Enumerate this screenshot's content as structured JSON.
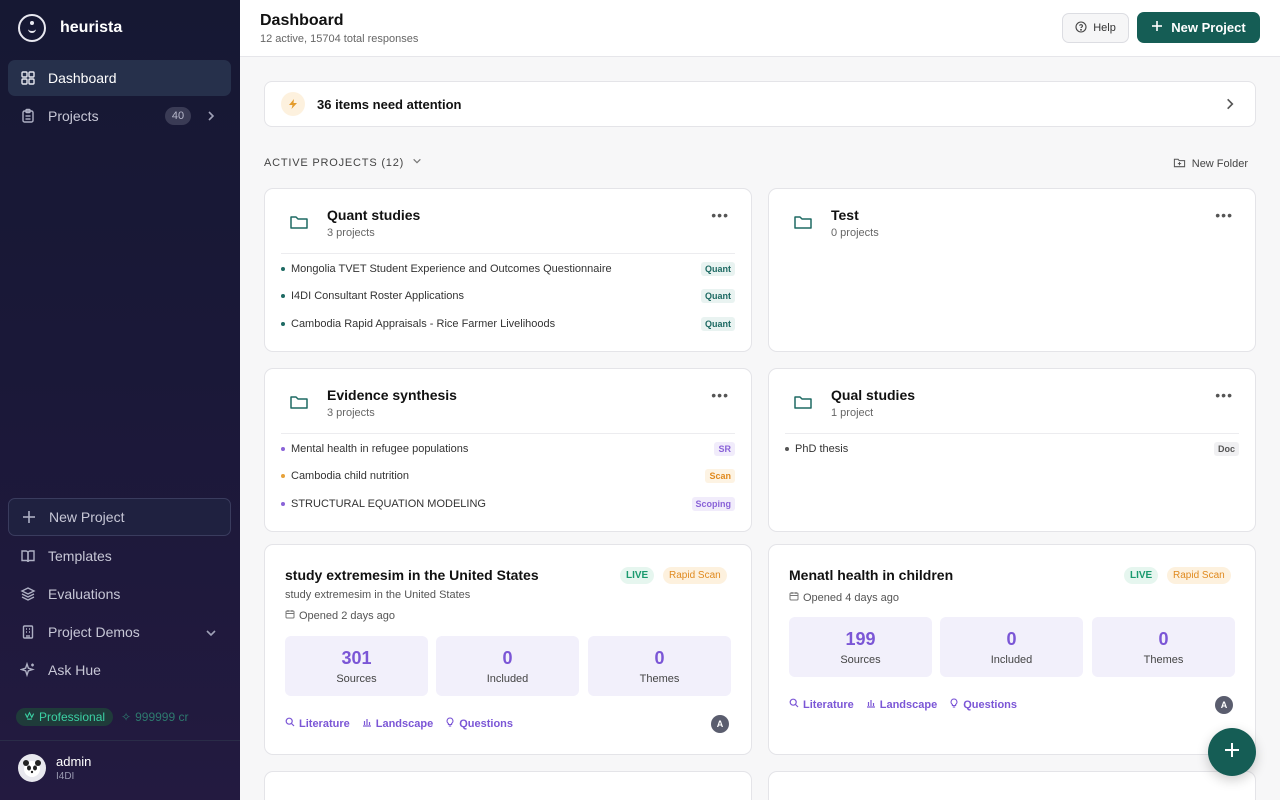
{
  "brand": {
    "name": "heurista"
  },
  "nav": {
    "dashboard": "Dashboard",
    "projects": "Projects",
    "projects_count": "40",
    "new_project": "New Project",
    "templates": "Templates",
    "evaluations": "Evaluations",
    "project_demos": "Project Demos",
    "ask_hue": "Ask Hue"
  },
  "plan": {
    "name": "Professional",
    "credits": "999999 cr"
  },
  "user": {
    "name": "admin",
    "org": "I4DI"
  },
  "header": {
    "title": "Dashboard",
    "subtitle": "12 active, 15704 total responses",
    "help": "Help",
    "new_project": "New Project"
  },
  "attention": {
    "text": "36 items need attention"
  },
  "section": {
    "title": "ACTIVE PROJECTS (12)",
    "new_folder": "New Folder"
  },
  "folders": [
    {
      "title": "Quant studies",
      "count": "3 projects",
      "projects": [
        {
          "name": "Mongolia TVET Student Experience and Outcomes Questionnaire",
          "tag": "Quant"
        },
        {
          "name": "I4DI Consultant Roster Applications",
          "tag": "Quant"
        },
        {
          "name": "Cambodia Rapid Appraisals - Rice Farmer Livelihoods",
          "tag": "Quant"
        }
      ]
    },
    {
      "title": "Test",
      "count": "0 projects",
      "projects": []
    },
    {
      "title": "Evidence synthesis",
      "count": "3 projects",
      "projects": [
        {
          "name": "Mental health in refugee populations",
          "tag": "SR"
        },
        {
          "name": "Cambodia child nutrition",
          "tag": "Scan"
        },
        {
          "name": "STRUCTURAL EQUATION MODELING",
          "tag": "Scoping"
        }
      ]
    },
    {
      "title": "Qual studies",
      "count": "1 project",
      "projects": [
        {
          "name": "PhD thesis",
          "tag": "Doc"
        }
      ]
    }
  ],
  "project_cards": [
    {
      "title": "study extremesim in the United States",
      "live": "LIVE",
      "type": "Rapid Scan",
      "desc": "study extremesim in the United States",
      "opened": "Opened 2 days ago",
      "sources": "301",
      "sources_label": "Sources",
      "included": "0",
      "included_label": "Included",
      "themes": "0",
      "themes_label": "Themes",
      "links": [
        "Literature",
        "Landscape",
        "Questions"
      ],
      "avatar": "A"
    },
    {
      "title": "Menatl health in children",
      "live": "LIVE",
      "type": "Rapid Scan",
      "opened": "Opened 4 days ago",
      "sources": "199",
      "sources_label": "Sources",
      "included": "0",
      "included_label": "Included",
      "themes": "0",
      "themes_label": "Themes",
      "links": [
        "Literature",
        "Landscape",
        "Questions"
      ],
      "avatar": "A"
    }
  ],
  "colors": {
    "accent": "#155d55",
    "purple": "#7b56d6",
    "sidebar": "#161833"
  }
}
